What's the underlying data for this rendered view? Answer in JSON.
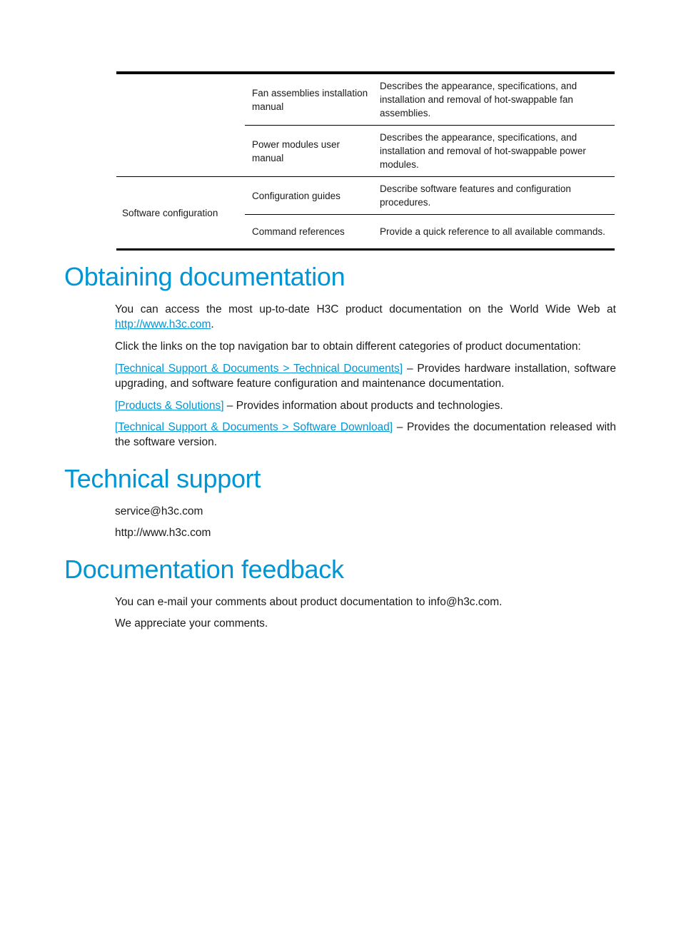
{
  "table": {
    "rows": [
      {
        "category": "",
        "document": "Fan assemblies installation manual",
        "description": "Describes the appearance, specifications, and installation and removal of hot-swappable fan assemblies."
      },
      {
        "category": "",
        "document": "Power modules user manual",
        "description": "Describes the appearance, specifications, and installation and removal of hot-swappable power modules."
      },
      {
        "category": "Software configuration",
        "document": "Configuration guides",
        "description": "Describe software features and configuration procedures."
      },
      {
        "category": "Software configuration",
        "document": "Command references",
        "description": "Provide a quick reference to all available commands."
      }
    ]
  },
  "obtaining": {
    "heading": "Obtaining documentation",
    "intro_text": "You can access the most up-to-date H3C product documentation on the World Wide Web at ",
    "intro_link": "http://www.h3c.com",
    "intro_end": ".",
    "nav_text": "Click the links on the top navigation bar to obtain different categories of product documentation:",
    "links": [
      {
        "label": "[Technical Support & Documents > Technical Documents]",
        "text": " – Provides hardware installation, software upgrading, and software feature configuration and maintenance documentation."
      },
      {
        "label": "[Products & Solutions]",
        "text": " – Provides information about products and technologies."
      },
      {
        "label": "[Technical Support & Documents > Software Download]",
        "text": " – Provides the documentation released with the software version."
      }
    ]
  },
  "support": {
    "heading": "Technical support",
    "email": "service@h3c.com",
    "website": "http://www.h3c.com"
  },
  "feedback": {
    "heading": "Documentation feedback",
    "line1": "You can e-mail your comments about product documentation to info@h3c.com.",
    "line2": "We appreciate your comments."
  },
  "colors": {
    "heading": "#0096d6",
    "link": "#0096d6"
  }
}
